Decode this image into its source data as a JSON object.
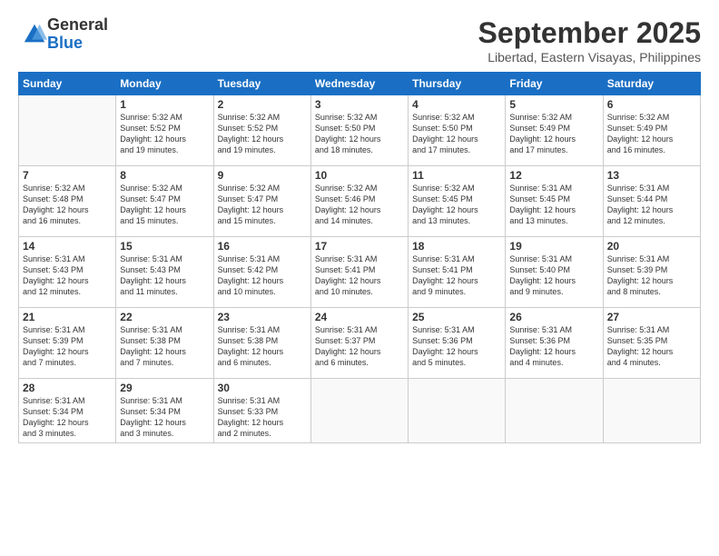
{
  "logo": {
    "general": "General",
    "blue": "Blue"
  },
  "header": {
    "month": "September 2025",
    "location": "Libertad, Eastern Visayas, Philippines"
  },
  "weekdays": [
    "Sunday",
    "Monday",
    "Tuesday",
    "Wednesday",
    "Thursday",
    "Friday",
    "Saturday"
  ],
  "weeks": [
    [
      {
        "day": "",
        "info": ""
      },
      {
        "day": "1",
        "info": "Sunrise: 5:32 AM\nSunset: 5:52 PM\nDaylight: 12 hours\nand 19 minutes."
      },
      {
        "day": "2",
        "info": "Sunrise: 5:32 AM\nSunset: 5:52 PM\nDaylight: 12 hours\nand 19 minutes."
      },
      {
        "day": "3",
        "info": "Sunrise: 5:32 AM\nSunset: 5:50 PM\nDaylight: 12 hours\nand 18 minutes."
      },
      {
        "day": "4",
        "info": "Sunrise: 5:32 AM\nSunset: 5:50 PM\nDaylight: 12 hours\nand 17 minutes."
      },
      {
        "day": "5",
        "info": "Sunrise: 5:32 AM\nSunset: 5:49 PM\nDaylight: 12 hours\nand 17 minutes."
      },
      {
        "day": "6",
        "info": "Sunrise: 5:32 AM\nSunset: 5:49 PM\nDaylight: 12 hours\nand 16 minutes."
      }
    ],
    [
      {
        "day": "7",
        "info": "Sunrise: 5:32 AM\nSunset: 5:48 PM\nDaylight: 12 hours\nand 16 minutes."
      },
      {
        "day": "8",
        "info": "Sunrise: 5:32 AM\nSunset: 5:47 PM\nDaylight: 12 hours\nand 15 minutes."
      },
      {
        "day": "9",
        "info": "Sunrise: 5:32 AM\nSunset: 5:47 PM\nDaylight: 12 hours\nand 15 minutes."
      },
      {
        "day": "10",
        "info": "Sunrise: 5:32 AM\nSunset: 5:46 PM\nDaylight: 12 hours\nand 14 minutes."
      },
      {
        "day": "11",
        "info": "Sunrise: 5:32 AM\nSunset: 5:45 PM\nDaylight: 12 hours\nand 13 minutes."
      },
      {
        "day": "12",
        "info": "Sunrise: 5:31 AM\nSunset: 5:45 PM\nDaylight: 12 hours\nand 13 minutes."
      },
      {
        "day": "13",
        "info": "Sunrise: 5:31 AM\nSunset: 5:44 PM\nDaylight: 12 hours\nand 12 minutes."
      }
    ],
    [
      {
        "day": "14",
        "info": "Sunrise: 5:31 AM\nSunset: 5:43 PM\nDaylight: 12 hours\nand 12 minutes."
      },
      {
        "day": "15",
        "info": "Sunrise: 5:31 AM\nSunset: 5:43 PM\nDaylight: 12 hours\nand 11 minutes."
      },
      {
        "day": "16",
        "info": "Sunrise: 5:31 AM\nSunset: 5:42 PM\nDaylight: 12 hours\nand 10 minutes."
      },
      {
        "day": "17",
        "info": "Sunrise: 5:31 AM\nSunset: 5:41 PM\nDaylight: 12 hours\nand 10 minutes."
      },
      {
        "day": "18",
        "info": "Sunrise: 5:31 AM\nSunset: 5:41 PM\nDaylight: 12 hours\nand 9 minutes."
      },
      {
        "day": "19",
        "info": "Sunrise: 5:31 AM\nSunset: 5:40 PM\nDaylight: 12 hours\nand 9 minutes."
      },
      {
        "day": "20",
        "info": "Sunrise: 5:31 AM\nSunset: 5:39 PM\nDaylight: 12 hours\nand 8 minutes."
      }
    ],
    [
      {
        "day": "21",
        "info": "Sunrise: 5:31 AM\nSunset: 5:39 PM\nDaylight: 12 hours\nand 7 minutes."
      },
      {
        "day": "22",
        "info": "Sunrise: 5:31 AM\nSunset: 5:38 PM\nDaylight: 12 hours\nand 7 minutes."
      },
      {
        "day": "23",
        "info": "Sunrise: 5:31 AM\nSunset: 5:38 PM\nDaylight: 12 hours\nand 6 minutes."
      },
      {
        "day": "24",
        "info": "Sunrise: 5:31 AM\nSunset: 5:37 PM\nDaylight: 12 hours\nand 6 minutes."
      },
      {
        "day": "25",
        "info": "Sunrise: 5:31 AM\nSunset: 5:36 PM\nDaylight: 12 hours\nand 5 minutes."
      },
      {
        "day": "26",
        "info": "Sunrise: 5:31 AM\nSunset: 5:36 PM\nDaylight: 12 hours\nand 4 minutes."
      },
      {
        "day": "27",
        "info": "Sunrise: 5:31 AM\nSunset: 5:35 PM\nDaylight: 12 hours\nand 4 minutes."
      }
    ],
    [
      {
        "day": "28",
        "info": "Sunrise: 5:31 AM\nSunset: 5:34 PM\nDaylight: 12 hours\nand 3 minutes."
      },
      {
        "day": "29",
        "info": "Sunrise: 5:31 AM\nSunset: 5:34 PM\nDaylight: 12 hours\nand 3 minutes."
      },
      {
        "day": "30",
        "info": "Sunrise: 5:31 AM\nSunset: 5:33 PM\nDaylight: 12 hours\nand 2 minutes."
      },
      {
        "day": "",
        "info": ""
      },
      {
        "day": "",
        "info": ""
      },
      {
        "day": "",
        "info": ""
      },
      {
        "day": "",
        "info": ""
      }
    ]
  ]
}
